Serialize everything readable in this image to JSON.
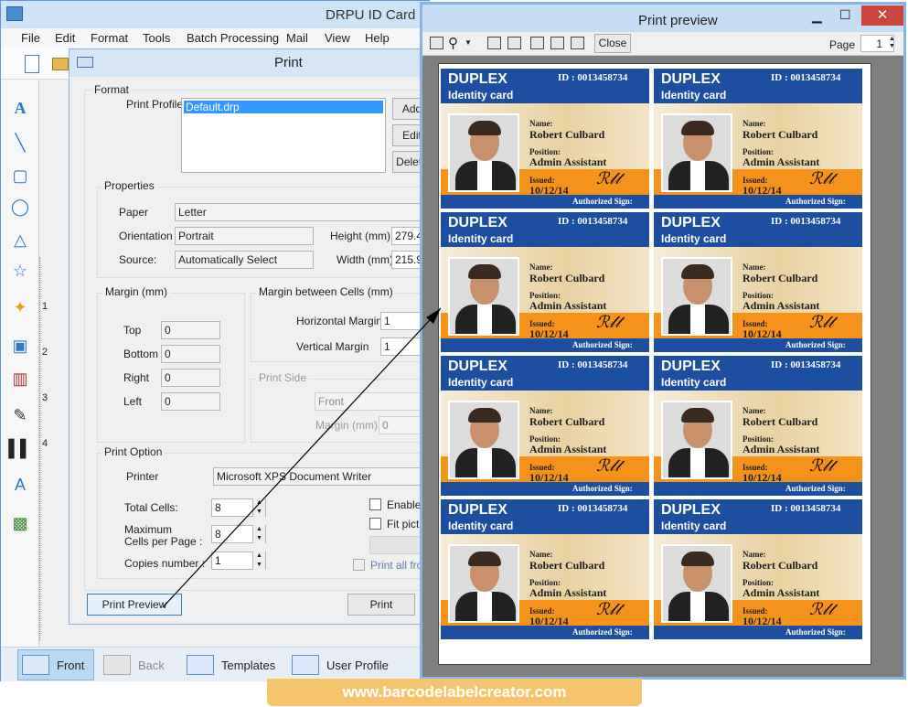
{
  "app": {
    "title": "DRPU ID Card D",
    "menu": [
      "File",
      "Edit",
      "Format",
      "Tools",
      "Batch Processing",
      "Mail",
      "View",
      "Help"
    ]
  },
  "dialog": {
    "title": "Print",
    "format_group": "Format",
    "print_profile_label": "Print Profile",
    "profile_selected": "Default.drp",
    "add_button": "Add",
    "edit_button": "Edit",
    "delete_button": "Delete",
    "properties_group": "Properties",
    "paper_label": "Paper",
    "paper_value": "Letter",
    "orientation_label": "Orientation",
    "orientation_value": "Portrait",
    "height_label": "Height (mm)",
    "height_value": "279.4",
    "source_label": "Source:",
    "source_value": "Automatically Select",
    "width_label": "Width (mm)",
    "width_value": "215.9",
    "margin_group": "Margin (mm)",
    "top_label": "Top",
    "top_value": "0",
    "bottom_label": "Bottom",
    "bottom_value": "0",
    "right_label": "Right",
    "right_value": "0",
    "left_label": "Left",
    "left_value": "0",
    "cell_margin_group": "Margin between Cells (mm)",
    "hmargin_label": "Horizontal Margin",
    "hmargin_value": "1",
    "vmargin_label": "Vertical Margin",
    "vmargin_value": "1",
    "print_side_group": "Print Side",
    "print_side_value": "Front",
    "side_margin_label": "Margin (mm)",
    "side_margin_value": "0",
    "print_option_group": "Print Option",
    "printer_label": "Printer",
    "printer_value": "Microsoft XPS Document Writer",
    "total_cells_label": "Total Cells:",
    "total_cells_value": "8",
    "max_cells_label_1": "Maximum",
    "max_cells_label_2": "Cells per Page :",
    "max_cells_value": "8",
    "copies_label": "Copies number :",
    "copies_value": "1",
    "enable_label": "Enable c",
    "fit_label": "Fit pictu",
    "print_all_label": "Print all from",
    "print_preview_button": "Print Preview",
    "print_button": "Print"
  },
  "bottom_tabs": [
    "Front",
    "Back",
    "Templates",
    "User Profile"
  ],
  "ruler_marks": [
    "1",
    "2",
    "3",
    "4"
  ],
  "preview": {
    "title": "Print preview",
    "close_button": "Close",
    "page_label": "Page",
    "page_value": "1"
  },
  "card": {
    "company": "DUPLEX",
    "subtitle": "Identity card",
    "id_text": "ID : 0013458734",
    "name_label": "Name:",
    "name": "Robert Culbard",
    "position_label": "Position:",
    "position": "Admin Assistant",
    "issued_label": "Issued:",
    "issued": "10/12/14",
    "auth_label": "Authorized Sign:"
  },
  "watermark": "www.barcodelabelcreator.com"
}
